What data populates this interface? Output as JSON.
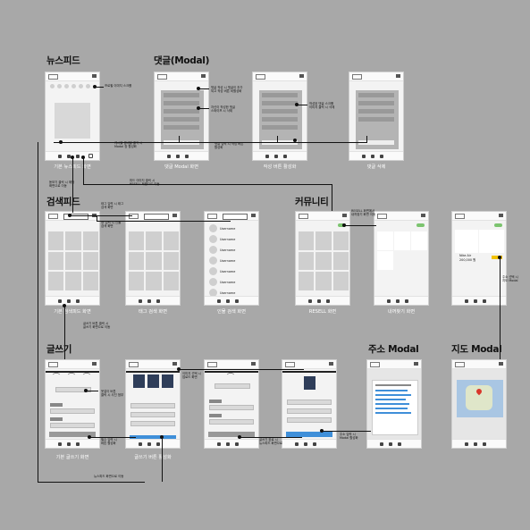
{
  "sections": {
    "newsfeed": "뉴스피드",
    "comment": "댓글(Modal)",
    "search": "검색피드",
    "community": "커뮤니티",
    "write": "글쓰기",
    "address": "주소 Modal",
    "map": "지도 Modal"
  },
  "captions": {
    "c1": "기본 뉴스피드 화면",
    "c2": "댓글 Modal 화면",
    "c3": "작성 버튼 활성화",
    "c4": "댓글 삭제",
    "c5": "기본 검색피드 화면",
    "c6": "태그 검색 화면",
    "c7": "인물 검색 화면",
    "c8": "RESELL 화면",
    "c9": "내꺼찾기 화면",
    "c10": "기본 글쓰기 화면",
    "c11": "글쓰기 버튼 활성화"
  },
  "notes": {
    "n1": "프로필 이미지 스크롤",
    "n2a": "게시물 썸네일 클릭 시",
    "n2b": "Modal 창 활성화",
    "n3a": "댓글 입력 시 작성 버튼",
    "n3b": "활성화",
    "n4a": "작성된 댓글 스크롤",
    "n4b": "이미지 클릭 시 삭제",
    "n5a": "댓글 작성 시 댓글이 추가",
    "n5b": "되고 작성 버튼 비활성화",
    "n6a": "자신이 작성한 댓글",
    "n6b": "스와이프 시 삭제",
    "n7a": "돋보기 클릭 시 해당",
    "n7b": "화면으로 이동",
    "n8a": "피드 이미지 클릭 시",
    "n8b": "RESELL 화면으로 이동",
    "n9a": "태그 입력 시 태그",
    "n9b": "검색 화면",
    "n10a": "@ 입력 시 인물",
    "n10b": "검색 화면",
    "n11a": "글쓰기 버튼 클릭 시",
    "n11b": "글쓰기 화면으로 이동",
    "n12a": "RESELL 화면에서",
    "n12b": "내꺼찾기 화면 이동",
    "n13a": "옷걸이 버튼",
    "n13b": "클릭 시 사진 첨부",
    "n14a": "이미지 선택 시",
    "n14b": "업로드 화면",
    "n15a": "필수 입력 시",
    "n15b": "버튼 활성화",
    "n16a": "글쓰기 완료 시",
    "n16b": "뉴스피드 화면으로",
    "n17a": "주소 입력 시",
    "n17b": "Modal 활성화",
    "n18a": "주소 선택 시",
    "n18b": "지도 Modal",
    "n19": "뉴스피드 화면으로 이동"
  },
  "screen_labels": {
    "resell_price": "200,000 원",
    "resell_name": "Nike Air",
    "search_bar": "Q",
    "person1": "Username",
    "person2": "Username",
    "person3": "Username",
    "person4": "Username",
    "person5": "Username",
    "person6": "Username",
    "person7": "Username"
  }
}
